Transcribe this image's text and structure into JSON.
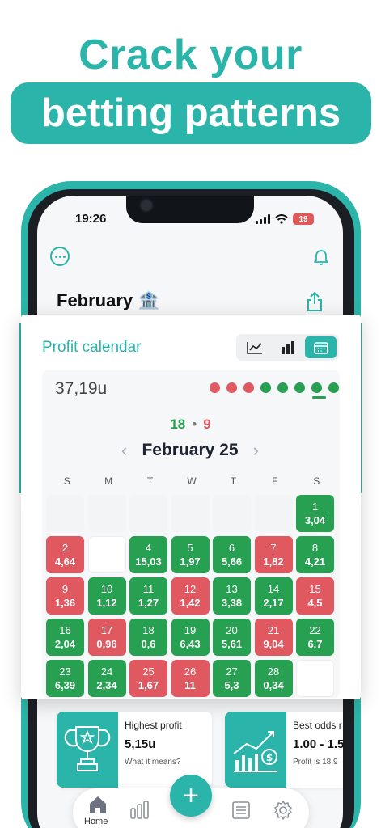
{
  "promo": {
    "line1": "Crack your",
    "line2": "betting patterns"
  },
  "status_bar": {
    "time": "19:26",
    "battery": "19"
  },
  "header": {
    "month_title": "February 🏦"
  },
  "profit_card": {
    "title": "Profit calendar",
    "total": "37,19u",
    "result_dots": [
      "#e05860",
      "#e05860",
      "#e05860",
      "#27a052",
      "#27a052",
      "#27a052",
      "#27a052",
      "#27a052"
    ],
    "wins": "18",
    "separator": "•",
    "losses": "9",
    "month_label": "February 25",
    "prev_arrow": "‹",
    "next_arrow": "›",
    "weekdays": [
      "S",
      "M",
      "T",
      "W",
      "T",
      "F",
      "S"
    ],
    "days": [
      {
        "day": "",
        "value": "",
        "status": "blank"
      },
      {
        "day": "",
        "value": "",
        "status": "blank"
      },
      {
        "day": "",
        "value": "",
        "status": "blank"
      },
      {
        "day": "",
        "value": "",
        "status": "blank"
      },
      {
        "day": "",
        "value": "",
        "status": "blank"
      },
      {
        "day": "",
        "value": "",
        "status": "blank"
      },
      {
        "day": "1",
        "value": "3,04",
        "status": "win"
      },
      {
        "day": "2",
        "value": "4,64",
        "status": "loss"
      },
      {
        "day": "",
        "value": "",
        "status": "white"
      },
      {
        "day": "4",
        "value": "15,03",
        "status": "win"
      },
      {
        "day": "5",
        "value": "1,97",
        "status": "win"
      },
      {
        "day": "6",
        "value": "5,66",
        "status": "win"
      },
      {
        "day": "7",
        "value": "1,82",
        "status": "loss"
      },
      {
        "day": "8",
        "value": "4,21",
        "status": "win"
      },
      {
        "day": "9",
        "value": "1,36",
        "status": "loss"
      },
      {
        "day": "10",
        "value": "1,12",
        "status": "win"
      },
      {
        "day": "11",
        "value": "1,27",
        "status": "win"
      },
      {
        "day": "12",
        "value": "1,42",
        "status": "loss"
      },
      {
        "day": "13",
        "value": "3,38",
        "status": "win"
      },
      {
        "day": "14",
        "value": "2,17",
        "status": "win"
      },
      {
        "day": "15",
        "value": "4,5",
        "status": "loss"
      },
      {
        "day": "16",
        "value": "2,04",
        "status": "win"
      },
      {
        "day": "17",
        "value": "0,96",
        "status": "loss"
      },
      {
        "day": "18",
        "value": "0,6",
        "status": "win"
      },
      {
        "day": "19",
        "value": "6,43",
        "status": "win"
      },
      {
        "day": "20",
        "value": "5,61",
        "status": "win"
      },
      {
        "day": "21",
        "value": "9,04",
        "status": "loss"
      },
      {
        "day": "22",
        "value": "6,7",
        "status": "win"
      },
      {
        "day": "23",
        "value": "6,39",
        "status": "win"
      },
      {
        "day": "24",
        "value": "2,34",
        "status": "win"
      },
      {
        "day": "25",
        "value": "1,67",
        "status": "loss"
      },
      {
        "day": "26",
        "value": "11",
        "status": "loss"
      },
      {
        "day": "27",
        "value": "5,3",
        "status": "win"
      },
      {
        "day": "28",
        "value": "0,34",
        "status": "win"
      },
      {
        "day": "",
        "value": "",
        "status": "white"
      }
    ]
  },
  "stats": [
    {
      "title": "Highest profit",
      "value": "5,15u",
      "note": "What it means?"
    },
    {
      "title": "Best odds r",
      "value": "1.00 - 1.5",
      "note": "Profit is 18,9"
    }
  ],
  "bottom_nav": {
    "home_label": "Home",
    "fab_label": "+"
  },
  "colors": {
    "accent": "#2bb5aa",
    "win": "#27a052",
    "loss": "#e05860"
  }
}
